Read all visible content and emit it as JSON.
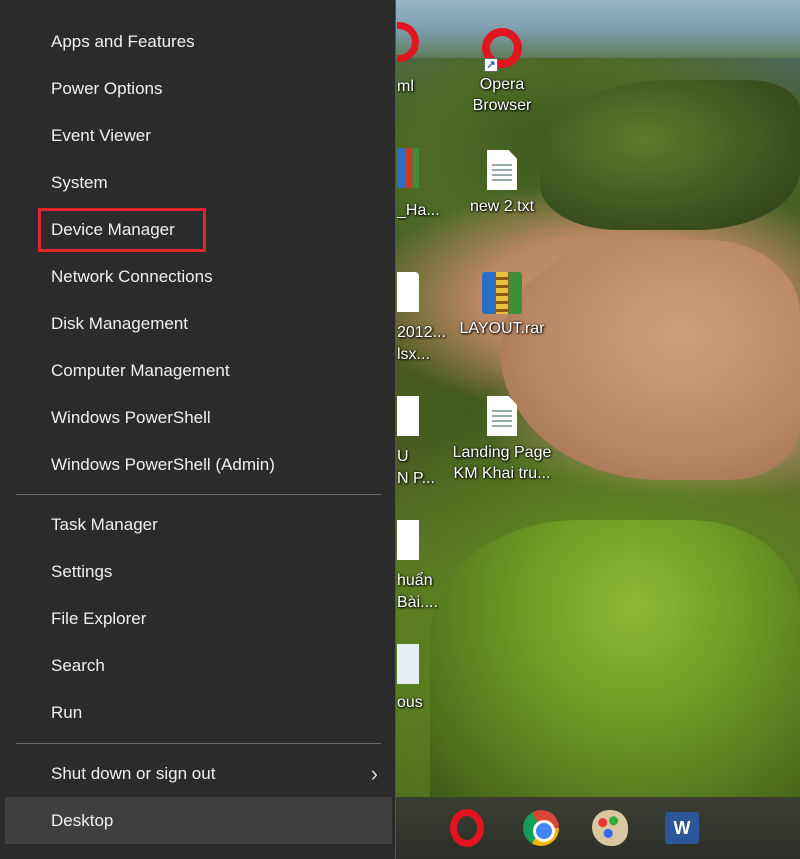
{
  "menu": {
    "group1": [
      {
        "label": "Apps and Features"
      },
      {
        "label": "Power Options"
      },
      {
        "label": "Event Viewer"
      },
      {
        "label": "System"
      },
      {
        "label": "Device Manager"
      },
      {
        "label": "Network Connections"
      },
      {
        "label": "Disk Management"
      },
      {
        "label": "Computer Management"
      },
      {
        "label": "Windows PowerShell"
      },
      {
        "label": "Windows PowerShell (Admin)"
      }
    ],
    "group2": [
      {
        "label": "Task Manager"
      },
      {
        "label": "Settings"
      },
      {
        "label": "File Explorer"
      },
      {
        "label": "Search"
      },
      {
        "label": "Run"
      }
    ],
    "shutdown": {
      "label": "Shut down or sign out",
      "arrow": "›"
    },
    "desktop": {
      "label": "Desktop"
    },
    "highlighted_item": "Device Manager",
    "highlight_color": "#e3242b"
  },
  "desktop_icons": [
    {
      "label_line1": "Opera",
      "label_line2": "Browser",
      "icon": "opera-icon"
    },
    {
      "label_line1": "new 2.txt",
      "label_line2": "",
      "icon": "text-file-icon"
    },
    {
      "label_line1": "LAYOUT.rar",
      "label_line2": "",
      "icon": "winrar-icon"
    },
    {
      "label_line1": "Landing Page",
      "label_line2": "KM Khai tru...",
      "icon": "blank-file-icon"
    }
  ],
  "partial_icons": [
    {
      "text": "ml"
    },
    {
      "text": "_Ha..."
    },
    {
      "text": "2012..."
    },
    {
      "text": "lsx..."
    },
    {
      "text": "U"
    },
    {
      "text": "N P..."
    },
    {
      "text": "huẩn"
    },
    {
      "text": "Bài...."
    },
    {
      "text": "ous"
    }
  ],
  "taskbar": {
    "icons": [
      "opera-icon",
      "chrome-icon",
      "paint-icon",
      "word-icon"
    ],
    "word_label": "W"
  }
}
